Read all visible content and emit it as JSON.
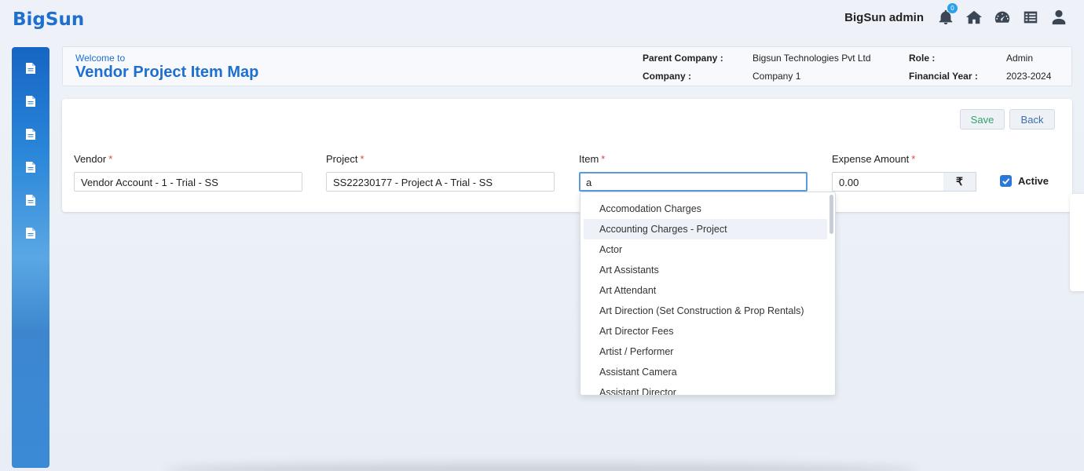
{
  "app": {
    "logo": "BigSun"
  },
  "topbar": {
    "user_name": "BigSun admin",
    "notification_count": "0",
    "icons": [
      "bell-icon",
      "home-icon",
      "dashboard-icon",
      "list-icon",
      "user-icon"
    ]
  },
  "sidebar": {
    "items": [
      {
        "icon": "document-icon"
      },
      {
        "icon": "document-icon"
      },
      {
        "icon": "document-icon"
      },
      {
        "icon": "document-icon"
      },
      {
        "icon": "document-icon"
      },
      {
        "icon": "document-icon"
      }
    ]
  },
  "header": {
    "welcome": "Welcome to",
    "title": "Vendor Project Item Map",
    "parent_company_label": "Parent Company :",
    "parent_company_value": "Bigsun Technologies Pvt Ltd",
    "company_label": "Company :",
    "company_value": "Company 1",
    "role_label": "Role :",
    "role_value": "Admin",
    "financial_year_label": "Financial Year :",
    "financial_year_value": "2023-2024"
  },
  "actions": {
    "save": "Save",
    "back": "Back"
  },
  "form": {
    "vendor": {
      "label": "Vendor",
      "required": "*",
      "value": "Vendor Account - 1 - Trial - SS"
    },
    "project": {
      "label": "Project",
      "required": "*",
      "value": "SS22230177 - Project A - Trial - SS"
    },
    "item": {
      "label": "Item",
      "required": "*",
      "value": "a"
    },
    "expense_amount": {
      "label": "Expense Amount",
      "required": "*",
      "value": "0.00",
      "currency_symbol": "₹"
    },
    "active": {
      "label": "Active",
      "checked": true
    }
  },
  "item_dropdown": {
    "options": [
      "Accomodation Charges",
      "Accounting Charges - Project",
      "Actor",
      "Art Assistants",
      "Art Attendant",
      "Art Direction (Set Construction & Prop Rentals)",
      "Art Director Fees",
      "Artist / Performer",
      "Assistant Camera",
      "Assistant Director"
    ],
    "highlighted": "Accounting Charges - Project"
  },
  "colors": {
    "brand": "#1e6fcf",
    "save_text": "#2fa36b",
    "required": "#e04848",
    "checkbox": "#2b78d8"
  }
}
